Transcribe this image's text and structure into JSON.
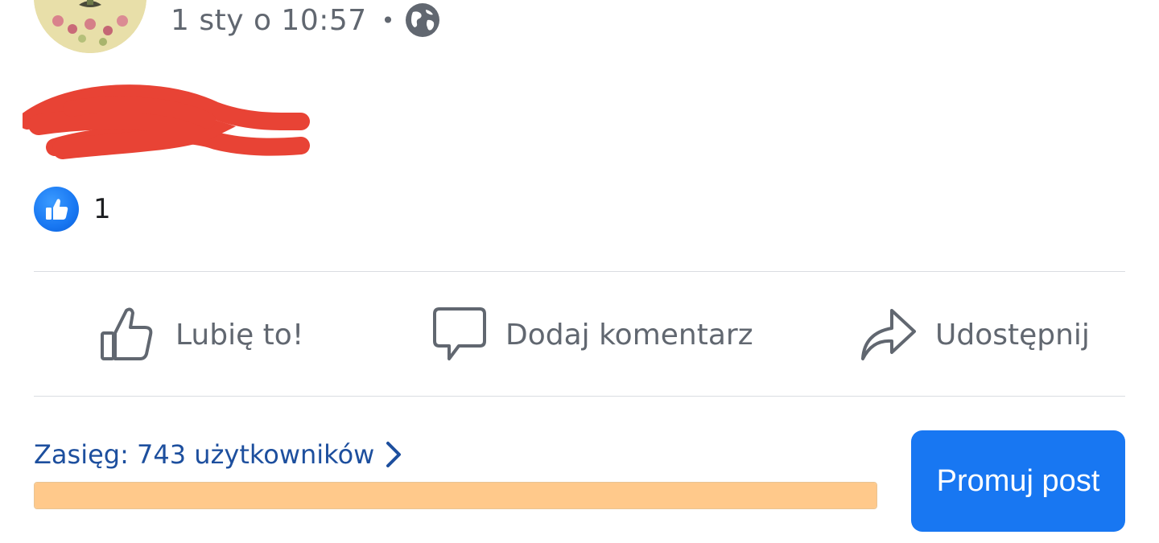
{
  "post": {
    "timestamp": "1 sty o 10:57",
    "separator": "•",
    "privacy_icon": "globe-icon"
  },
  "reactions": {
    "icon": "like-thumb-icon",
    "count": "1"
  },
  "actions": {
    "like_label": "Lubię to!",
    "comment_label": "Dodaj komentarz",
    "share_label": "Udostępnij"
  },
  "insights": {
    "reach_label": "Zasięg: 743 użytkowników",
    "progress_fraction": 1.0
  },
  "promote": {
    "label": "Promuj post"
  },
  "colors": {
    "accent": "#1877f2",
    "reach_text": "#1d4f9e",
    "progress": "#ffc98b",
    "redaction": "#e84335",
    "muted_text": "#616770"
  }
}
